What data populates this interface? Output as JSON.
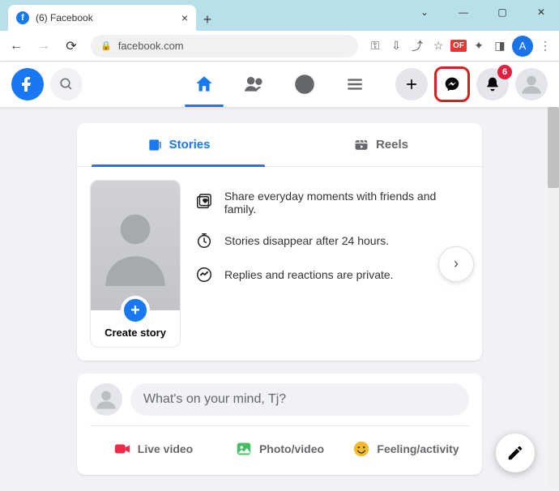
{
  "browser": {
    "tab_title": "(6) Facebook",
    "url": "facebook.com",
    "avatar_letter": "A",
    "ext_badge": "OF"
  },
  "fb": {
    "notif_count": "6"
  },
  "tabs": {
    "stories": "Stories",
    "reels": "Reels"
  },
  "story": {
    "create_label": "Create story",
    "info1": "Share everyday moments with friends and family.",
    "info2": "Stories disappear after 24 hours.",
    "info3": "Replies and reactions are private."
  },
  "composer": {
    "placeholder": "What's on your mind, Tj?",
    "live": "Live video",
    "photo": "Photo/video",
    "feeling": "Feeling/activity"
  }
}
